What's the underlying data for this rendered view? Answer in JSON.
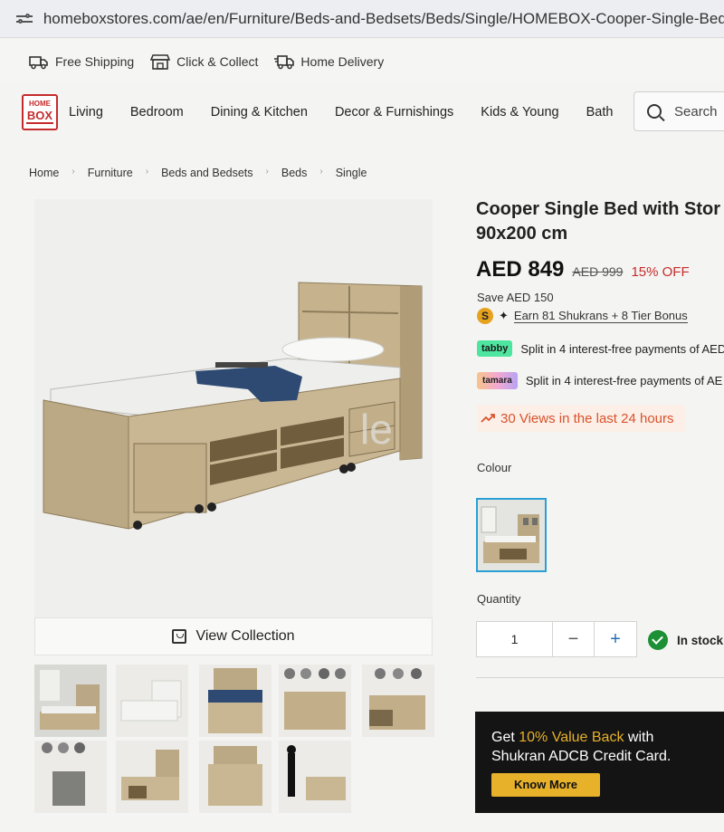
{
  "browser": {
    "url": "homeboxstores.com/ae/en/Furniture/Beds-and-Bedsets/Beds/Single/HOMEBOX-Cooper-Single-Bed-with-Stora"
  },
  "topstrip": {
    "items": [
      "Free Shipping",
      "Click & Collect",
      "Home Delivery"
    ]
  },
  "logo": {
    "line1": "HOME",
    "line2": "BOX"
  },
  "nav": {
    "items": [
      "Living",
      "Bedroom",
      "Dining & Kitchen",
      "Decor & Furnishings",
      "Kids & Young",
      "Bath"
    ],
    "search_placeholder": "Search"
  },
  "breadcrumb": [
    "Home",
    "Furniture",
    "Beds and Bedsets",
    "Beds",
    "Single"
  ],
  "gallery": {
    "view_collection": "View Collection",
    "watermark": "le"
  },
  "product": {
    "title_line1": "Cooper Single Bed with Stor",
    "title_line2": "90x200 cm",
    "price": "AED 849",
    "was_price": "AED 999",
    "discount": "15% OFF",
    "save": "Save AED 150",
    "shukran_badge": "S",
    "shukran_text": "Earn 81 Shukrans + 8   Tier Bonus",
    "tabby_logo": "tabby",
    "tabby_text": "Split in 4 interest-free payments of AED",
    "tamara_logo": "tamara",
    "tamara_text": "Split in 4 interest-free payments of AE",
    "views": "30 Views in the last 24 hours",
    "colour_label": "Colour",
    "quantity_label": "Quantity",
    "quantity_value": "1",
    "minus": "−",
    "plus": "+",
    "stock": "In stock"
  },
  "promo": {
    "pre": "Get ",
    "highlight": "10% Value Back",
    "post": " with",
    "line2": "Shukran ADCB Credit Card.",
    "button": "Know More"
  },
  "colors": {
    "accent_red": "#c52b2b",
    "swatch_border": "#2a9fd6",
    "views_orange": "#d9532b",
    "promo_gold": "#e8b12a",
    "stock_green": "#1d8f34"
  }
}
